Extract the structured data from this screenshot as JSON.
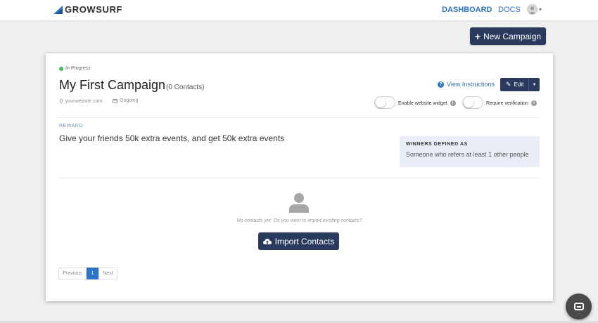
{
  "nav": {
    "brand": "GROWSURF",
    "dashboard": "DASHBOARD",
    "docs": "DOCS",
    "caret": "▾"
  },
  "actions": {
    "new_campaign": "New Campaign",
    "plus": "+"
  },
  "campaign": {
    "status": "In Progress",
    "status_color": "#3fbf5a",
    "title": "My First Campaign",
    "contacts": "(0 Contacts)",
    "website": "yourwebsite.com",
    "duration": "Ongoing",
    "view_instructions": "View Instructions",
    "edit": "Edit",
    "toggles": {
      "widget_label": "Enable website widget",
      "verification_label": "Require verification"
    },
    "reward_label": "REWARD",
    "reward_text": "Give your friends 50k extra events, and get 50k extra events",
    "winners_title": "WINNERS DEFINED AS",
    "winners_text": "Someone who refers at least 1 other people",
    "empty_text": "No contacts yet. Do you want to import existing contacts?",
    "import_contacts": "Import Contacts"
  },
  "pagination": {
    "previous": "Previous",
    "current": "1",
    "next": "Next"
  },
  "colors": {
    "primary": "#2a3a5e",
    "link": "#2f73c6"
  }
}
